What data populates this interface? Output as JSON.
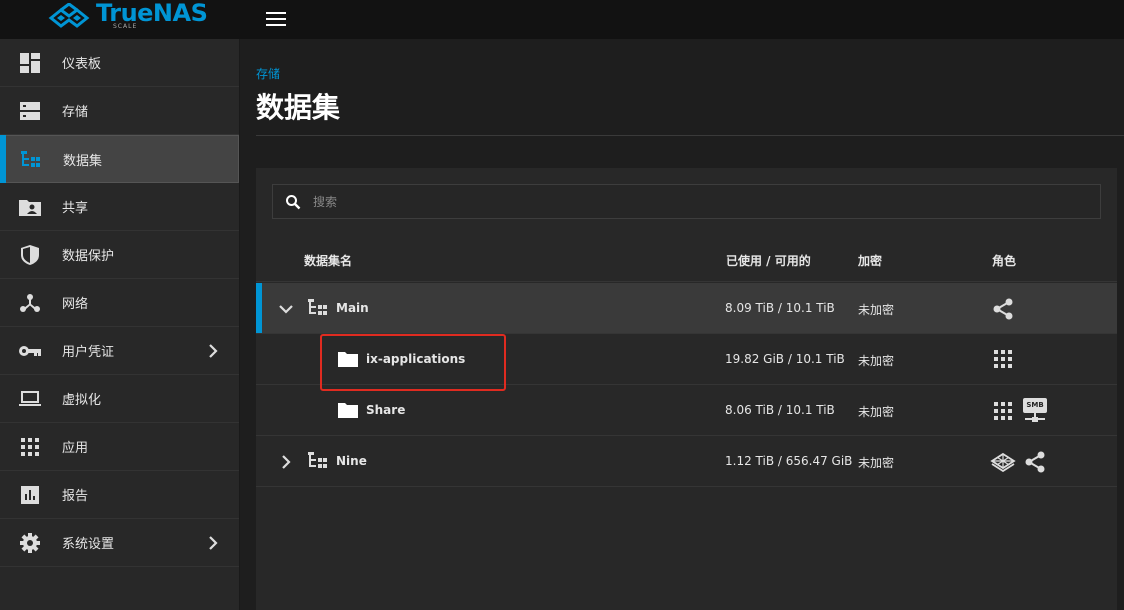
{
  "app": {
    "logo_text": "TrueNAS",
    "logo_sub": "SCALE",
    "accent": "#0095d5"
  },
  "sidebar": {
    "items": [
      {
        "label": "仪表板",
        "icon": "dashboard-icon"
      },
      {
        "label": "存储",
        "icon": "storage-icon"
      },
      {
        "label": "数据集",
        "icon": "datasets-icon",
        "active": true
      },
      {
        "label": "共享",
        "icon": "shares-icon"
      },
      {
        "label": "数据保护",
        "icon": "shield-icon"
      },
      {
        "label": "网络",
        "icon": "network-icon"
      },
      {
        "label": "用户凭证",
        "icon": "key-icon",
        "has_children": true
      },
      {
        "label": "虚拟化",
        "icon": "laptop-icon"
      },
      {
        "label": "应用",
        "icon": "apps-grid-icon"
      },
      {
        "label": "报告",
        "icon": "chart-icon"
      },
      {
        "label": "系统设置",
        "icon": "gear-icon",
        "has_children": true
      }
    ]
  },
  "header": {
    "breadcrumb": "存储",
    "title": "数据集"
  },
  "search": {
    "placeholder": "搜索"
  },
  "table": {
    "columns": {
      "name": "数据集名",
      "used": "已使用 / 可用的",
      "encryption": "加密",
      "roles": "角色"
    },
    "rows": [
      {
        "name": "Main",
        "used": "8.09 TiB / 10.1 TiB",
        "encryption": "未加密",
        "type": "pool",
        "expanded": true,
        "roles": [
          "share-icon"
        ]
      },
      {
        "name": "ix-applications",
        "used": "19.82 GiB / 10.1 TiB",
        "encryption": "未加密",
        "type": "folder",
        "roles": [
          "apps-grid-icon"
        ]
      },
      {
        "name": "Share",
        "used": "8.06 TiB / 10.1 TiB",
        "encryption": "未加密",
        "type": "folder",
        "roles": [
          "apps-grid-icon",
          "smb-icon"
        ]
      },
      {
        "name": "Nine",
        "used": "1.12 TiB / 656.47 GiB",
        "encryption": "未加密",
        "type": "pool",
        "expanded": false,
        "roles": [
          "layers-icon",
          "share-icon"
        ]
      }
    ],
    "smb_label": "SMB"
  },
  "colors": {
    "highlight": "#e02b20",
    "selected_row": "#3a3a3a"
  }
}
